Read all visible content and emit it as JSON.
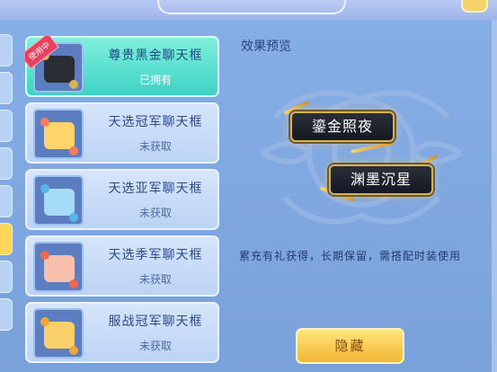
{
  "list": {
    "items": [
      {
        "name": "尊贵黑金聊天框",
        "status": "已拥有",
        "badge": "使用中",
        "selected": true,
        "thumb_color": "#2b2d34",
        "deco_color": "#d9b256"
      },
      {
        "name": "天选冠军聊天框",
        "status": "未获取",
        "selected": false,
        "thumb_color": "#ffd46a",
        "deco_color": "#ff7c5c"
      },
      {
        "name": "天选亚军聊天框",
        "status": "未获取",
        "selected": false,
        "thumb_color": "#a6dcf7",
        "deco_color": "#59b6e8"
      },
      {
        "name": "天选季军聊天框",
        "status": "未获取",
        "selected": false,
        "thumb_color": "#f8c0ad",
        "deco_color": "#ee6a4e"
      },
      {
        "name": "服战冠军聊天框",
        "status": "未获取",
        "selected": false,
        "thumb_color": "#f9cf6a",
        "deco_color": "#f2a63a"
      }
    ]
  },
  "preview": {
    "title": "效果预览",
    "bubble1": "鎏金照夜",
    "bubble2": "渊墨沉星",
    "description": "累充有礼获得，长期保留，需搭配时装使用"
  },
  "buttons": {
    "hide_label": "隐藏"
  },
  "colors": {
    "panel": "#86aee6",
    "selected_item": "#3fd2c4",
    "gold_button": "#f2b734",
    "badge": "#e8415d"
  }
}
